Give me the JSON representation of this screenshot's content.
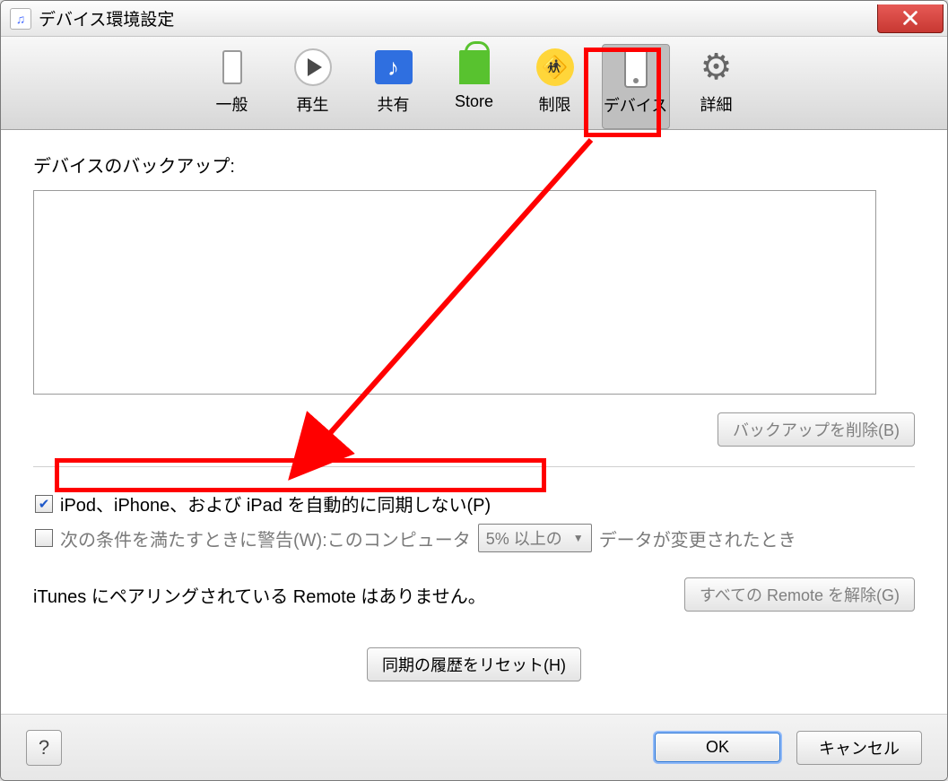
{
  "window": {
    "title": "デバイス環境設定"
  },
  "toolbar": {
    "tabs": [
      {
        "label": "一般"
      },
      {
        "label": "再生"
      },
      {
        "label": "共有"
      },
      {
        "label": "Store"
      },
      {
        "label": "制限"
      },
      {
        "label": "デバイス"
      },
      {
        "label": "詳細"
      }
    ]
  },
  "backup": {
    "label": "デバイスのバックアップ:",
    "delete_button": "バックアップを削除(B)"
  },
  "options": {
    "no_auto_sync": "iPod、iPhone、および iPad を自動的に同期しない(P)",
    "warn_prefix": "次の条件を満たすときに警告(W):このコンピュータ",
    "warn_threshold": "5% 以上の",
    "warn_suffix": "データが変更されたとき"
  },
  "remote": {
    "status": "iTunes にペアリングされている Remote はありません。",
    "forget_button": "すべての Remote を解除(G)"
  },
  "reset": {
    "button": "同期の履歴をリセット(H)"
  },
  "footer": {
    "help": "?",
    "ok": "OK",
    "cancel": "キャンセル"
  }
}
